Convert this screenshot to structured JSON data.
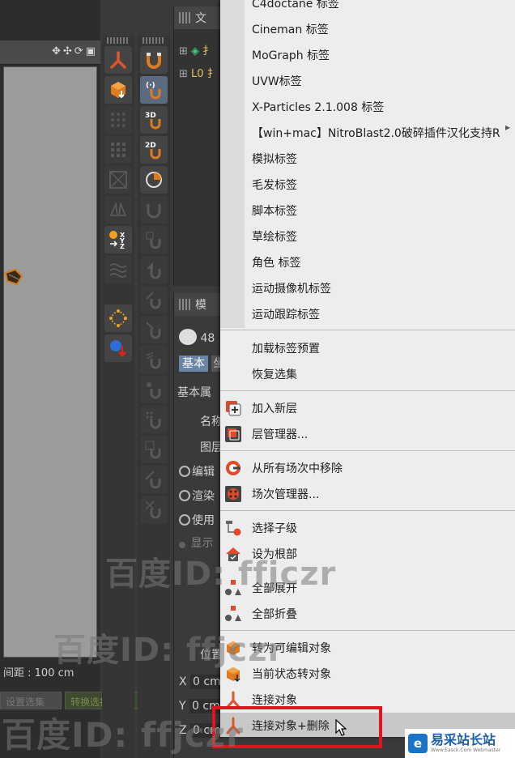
{
  "viewport": {
    "grid_distance": "间距 : 100 cm",
    "btn_reset_selection": "设置选集",
    "btn_convert_mode": "转换选择模式",
    "nav_icons": [
      "move-icon",
      "move-vertical-icon",
      "rotate-icon",
      "maximize-icon"
    ]
  },
  "objects_panel": {
    "header": "文",
    "row_1_label": "扌",
    "row_2_label": "L0 扌"
  },
  "attributes_panel": {
    "header": "模",
    "object_count": "48",
    "tab_basic": "基本",
    "tab_second": "坐",
    "section_title": "基本属",
    "field_name": "名称",
    "field_layer": "图层",
    "radio_edit": "编辑",
    "radio_render": "渲染",
    "radio_use": "使用",
    "radio_display": "显示",
    "position_header": "位置",
    "coord_x_label": "X",
    "coord_x_value": "0 cm",
    "coord_y_label": "Y",
    "coord_y_value": "0 cm",
    "coord_z_label": "Z",
    "coord_z_value": "0 cm"
  },
  "context_menu": {
    "items": [
      {
        "label": "C4doctane 标签",
        "color": "#1e1e1e"
      },
      {
        "label": "Cineman 标签",
        "color": "#1e1e1e"
      },
      {
        "label": "MoGraph 标签",
        "color": "#1e1e1e"
      },
      {
        "label": "UVW标签",
        "color": "#1e1e1e"
      },
      {
        "label": "X-Particles 2.1.008 标签",
        "color": "#1e1e1e"
      },
      {
        "label": "【win+mac】NitroBlast2.0破碎插件汉化支持R",
        "color": "#1e1e1e"
      },
      {
        "label": "模拟标签",
        "color": "#1e1e1e"
      },
      {
        "label": "毛发标签",
        "color": "#1e1e1e"
      },
      {
        "label": "脚本标签",
        "color": "#1e1e1e"
      },
      {
        "label": "草绘标签",
        "color": "#1e1e1e"
      },
      {
        "label": "角色 标签",
        "color": "#1e1e1e"
      },
      {
        "label": "运动摄像机标签",
        "color": "#1e1e1e"
      },
      {
        "label": "运动跟踪标签",
        "color": "#1e1e1e"
      }
    ],
    "preset_items": [
      {
        "label": "加载标签预置"
      },
      {
        "label": "恢复选集"
      }
    ],
    "layer_items": [
      {
        "label": "加入新层",
        "icon": "add-layer-icon"
      },
      {
        "label": "层管理器...",
        "icon": "layer-manager-icon"
      }
    ],
    "take_items": [
      {
        "label": "从所有场次中移除",
        "icon": "remove-take-icon"
      },
      {
        "label": "场次管理器...",
        "icon": "take-manager-icon"
      }
    ],
    "hierarchy_items": [
      {
        "label": "选择子级",
        "icon": "select-children-icon"
      },
      {
        "label": "设为根部",
        "icon": "set-root-icon"
      },
      {
        "label": "全部展开",
        "icon": "expand-all-icon"
      },
      {
        "label": "全部折叠",
        "icon": "collapse-all-icon"
      }
    ],
    "convert_items": [
      {
        "label": "转为可编辑对象",
        "icon": "make-editable-icon"
      },
      {
        "label": "当前状态转对象",
        "icon": "current-state-icon"
      },
      {
        "label": "连接对象",
        "icon": "connect-objects-icon"
      },
      {
        "label": "连接对象+删除",
        "icon": "connect-delete-icon"
      }
    ],
    "submenu_arrow": "▸"
  },
  "watermarks": [
    "百度ID: ffjczr",
    "百度ID: ffjczr",
    "百度ID: ffjczr"
  ],
  "site_logo": {
    "mark": "e",
    "title": "易采站长站",
    "subtitle": "Www.Easck.Com Webmaster"
  },
  "colors": {
    "menu_bg": "#ededed",
    "highlight_box": "#e0141e",
    "accent_blue": "#1b73c8"
  }
}
